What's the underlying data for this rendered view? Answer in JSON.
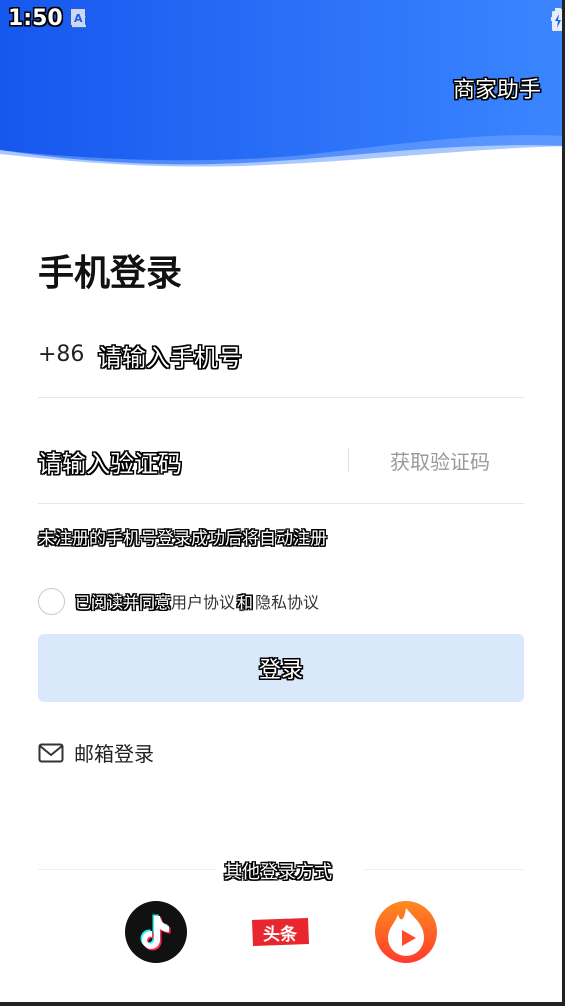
{
  "status_bar": {
    "time": "1:50",
    "left_icons": [
      "download-icon",
      "keyboard-a-icon"
    ],
    "right_icons": [
      "vibrate-icon",
      "wifi-icon",
      "signal-icon",
      "battery-icon"
    ]
  },
  "header": {
    "merchant_link": "商家助手",
    "gradient_start": "#1a5cf0",
    "gradient_end": "#3d8bff"
  },
  "login": {
    "title": "手机登录",
    "country_code": "+86",
    "phone_placeholder": "请输入手机号",
    "code_placeholder": "请输入验证码",
    "get_code": "获取验证码",
    "notice": "未注册的手机号登录成功后将自动注册",
    "agree_prefix": "已阅读并同意",
    "user_agreement": "用户协议",
    "and_text": "和",
    "privacy_policy": "隐私协议",
    "login_button": "登录",
    "button_color": "#d9e8fb",
    "email_login": "邮箱登录"
  },
  "other_login": {
    "label": "其他登录方式",
    "providers": [
      {
        "name": "douyin",
        "icon": "douyin-icon"
      },
      {
        "name": "toutiao",
        "icon": "toutiao-icon",
        "text": "头条"
      },
      {
        "name": "huoshan",
        "icon": "huoshan-icon"
      }
    ]
  }
}
